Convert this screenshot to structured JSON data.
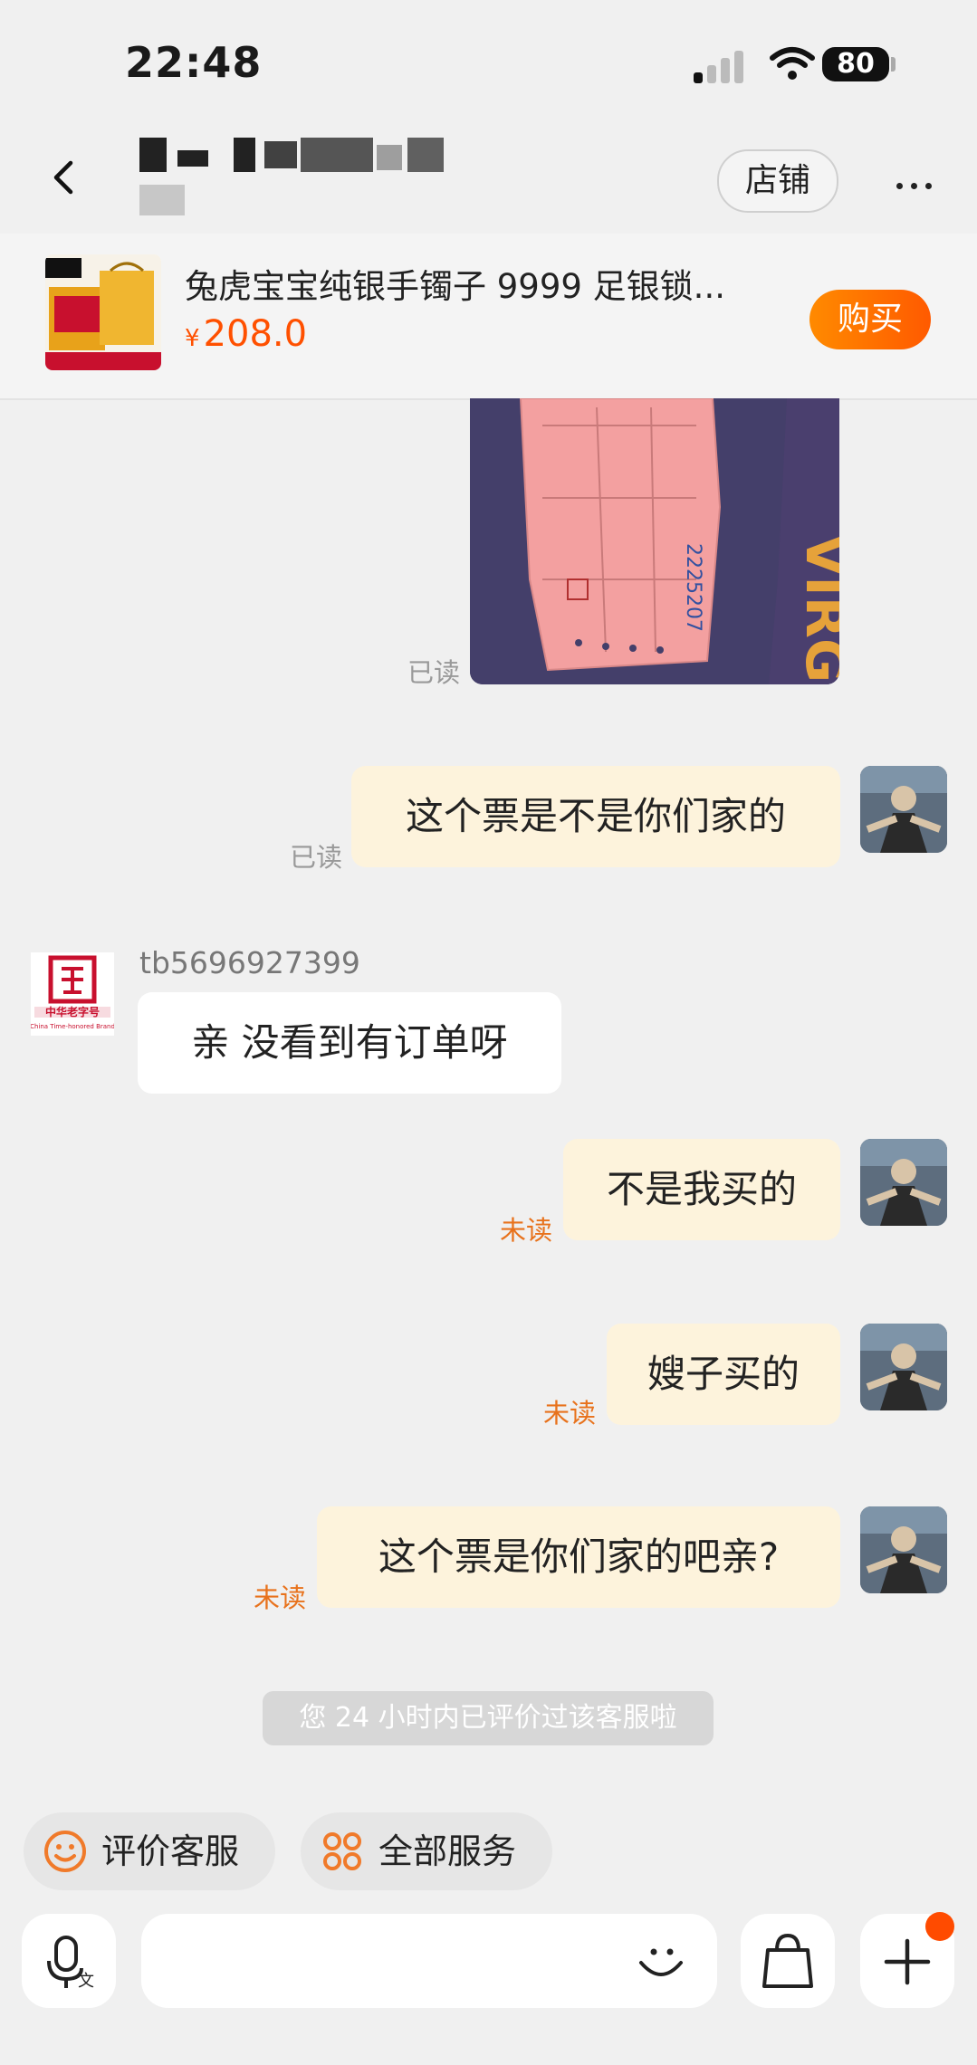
{
  "status_bar": {
    "time": "22:48",
    "battery": "80"
  },
  "header": {
    "shop_button": "店铺"
  },
  "product": {
    "title": "兔虎宝宝纯银手镯子 9999 足银锁...",
    "currency": "¥",
    "price": "208.0",
    "buy_label": "购买"
  },
  "messages": [
    {
      "from": "me",
      "text": "这个票是不是你们家的",
      "status": "已读"
    },
    {
      "from": "seller",
      "sender": "tb5696927399",
      "text": "亲  没看到有订单呀"
    },
    {
      "from": "me",
      "text": "不是我买的",
      "status": "未读"
    },
    {
      "from": "me",
      "text": "嫂子买的",
      "status": "未读"
    },
    {
      "from": "me",
      "text": "这个票是你们家的吧亲?",
      "status": "未读"
    }
  ],
  "photo_message": {
    "status": "已读"
  },
  "system_notice": "您 24 小时内已评价过该客服啦",
  "quick_actions": [
    {
      "label": "评价客服",
      "icon": "smiley-icon"
    },
    {
      "label": "全部服务",
      "icon": "grid-icon"
    }
  ],
  "colors": {
    "accent": "#ff5000",
    "my_bubble": "#fdf3dc",
    "unread": "#e8721c"
  }
}
